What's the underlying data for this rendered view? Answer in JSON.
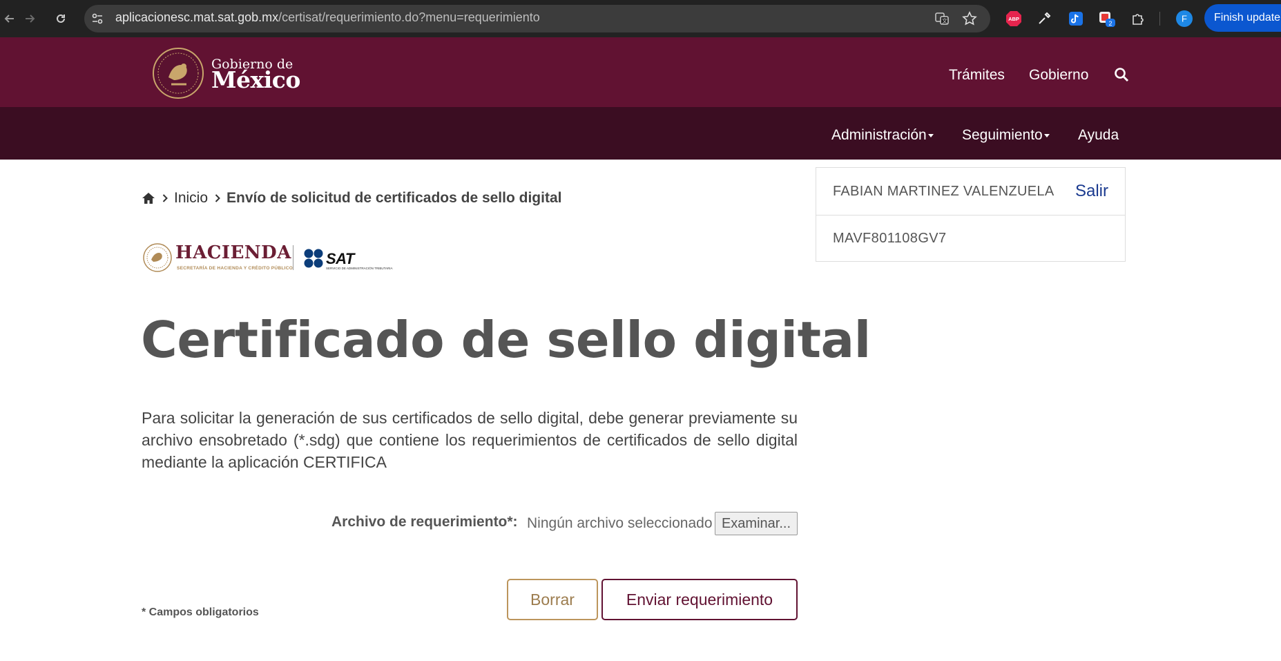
{
  "browser": {
    "url_domain": "aplicacionesc.mat.sat.gob.mx",
    "url_path": "/certisat/requerimiento.do?menu=requerimiento",
    "finish_update_label": "Finish update",
    "profile_initial": "F",
    "extension_badge": "2",
    "abp_label": "ABP"
  },
  "gov_header": {
    "logo_top": "Gobierno de",
    "logo_main": "México",
    "links": [
      "Trámites",
      "Gobierno"
    ]
  },
  "sub_nav": {
    "items": [
      "Administración",
      "Seguimiento",
      "Ayuda"
    ]
  },
  "breadcrumb": {
    "home": "Inicio",
    "current": "Envío de solicitud de certificados de sello digital"
  },
  "user_panel": {
    "name": "FABIAN MARTINEZ VALENZUELA",
    "logout_label": "Salir",
    "rfc": "MAVF801108GV7"
  },
  "logos": {
    "hacienda": "HACIENDA",
    "hacienda_sub": "SECRETARÍA DE HACIENDA Y CRÉDITO PÚBLICO",
    "sat": "SAT",
    "sat_sub": "SERVICIO DE ADMINISTRACIÓN TRIBUTARIA"
  },
  "content": {
    "title": "Certificado de sello digital",
    "description": "Para solicitar la generación de sus certificados de sello digital, debe generar previamente su archivo ensobretado (*.sdg) que contiene los requerimientos de certificados de sello digital mediante la aplicación CERTIFICA",
    "file_label": "Archivo de requerimiento*:",
    "file_status": "Ningún archivo seleccionado",
    "file_button": "Examinar...",
    "required_note": "* Campos obligatorios",
    "clear_button": "Borrar",
    "send_button": "Enviar requerimiento"
  },
  "colors": {
    "gov_primary": "#611232",
    "gov_dark": "#3b0d22",
    "gold": "#bc955c",
    "link_blue": "#1a3a8f"
  }
}
